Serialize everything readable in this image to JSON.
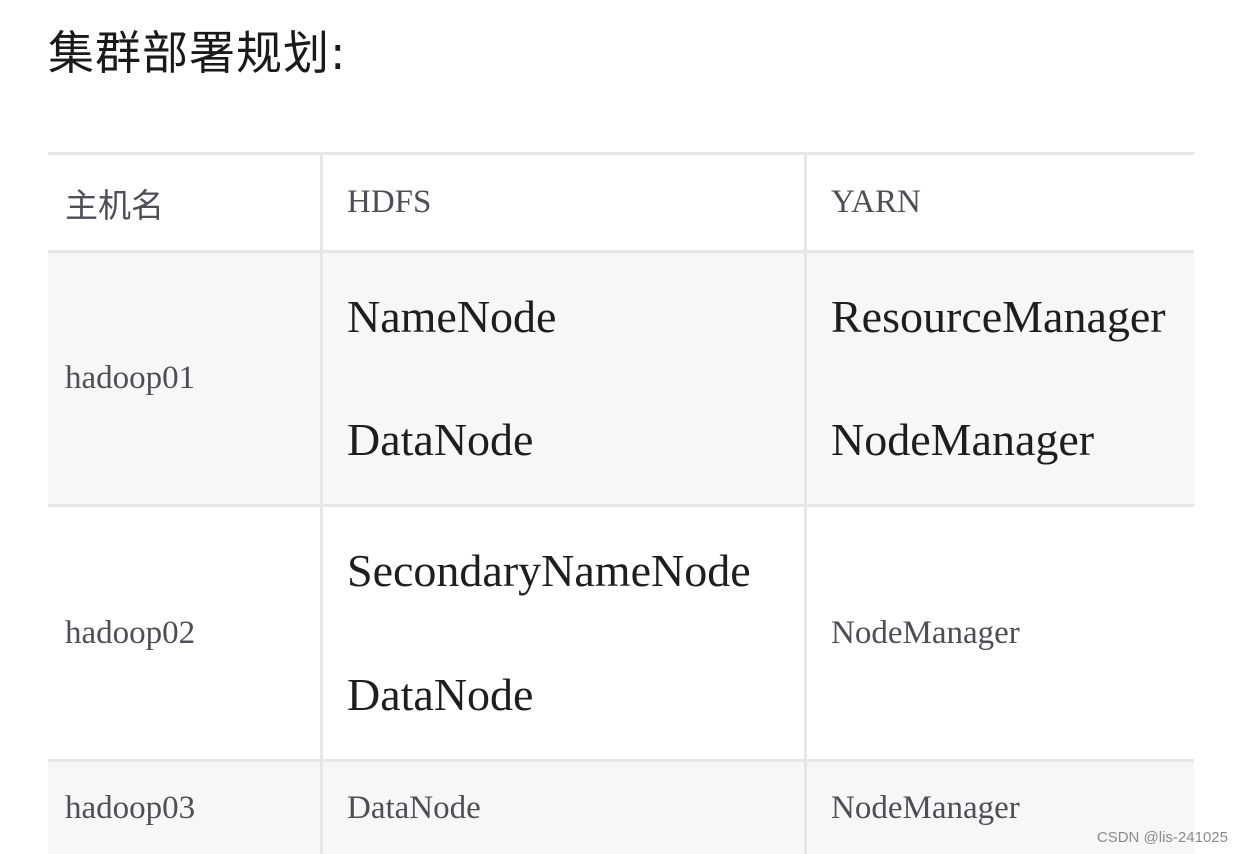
{
  "title": "集群部署规划:",
  "table": {
    "headers": [
      "主机名",
      "HDFS",
      "YARN"
    ],
    "rows": [
      {
        "host": "hadoop01",
        "hdfs": [
          "NameNode",
          "DataNode"
        ],
        "yarn": [
          "ResourceManager",
          "NodeManager"
        ]
      },
      {
        "host": "hadoop02",
        "hdfs": [
          "SecondaryNameNode",
          "DataNode"
        ],
        "yarn": [
          "NodeManager"
        ]
      },
      {
        "host": "hadoop03",
        "hdfs": [
          "DataNode"
        ],
        "yarn": [
          "NodeManager"
        ]
      }
    ]
  },
  "watermark": "CSDN @lis-241025"
}
